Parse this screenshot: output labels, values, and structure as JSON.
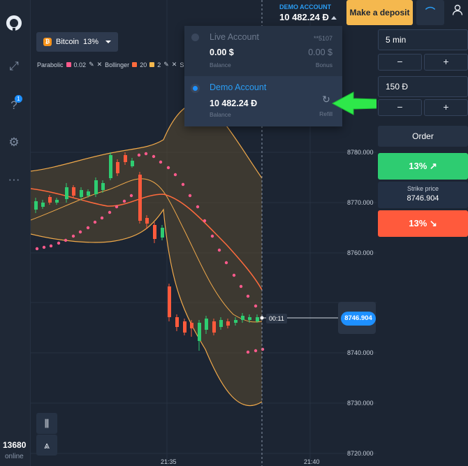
{
  "header": {
    "account_type": "DEMO ACCOUNT",
    "balance": "10 482.24 Đ",
    "deposit_label": "Make a deposit"
  },
  "asset": {
    "name": "Bitcoin",
    "payout": "13%"
  },
  "indicators": [
    {
      "name": "Parabolic",
      "value": "0.02",
      "color": "#ff5a8c"
    },
    {
      "name": "Bollinger",
      "value": "20",
      "color": "#ff6b3d"
    },
    {
      "name": "",
      "value": "2",
      "color": "#f5b84e"
    },
    {
      "name": "SMA",
      "value": "",
      "color": ""
    }
  ],
  "accounts": {
    "live": {
      "name": "Live Account",
      "id": "**5107",
      "balance": "0.00 $",
      "balance_label": "Balance",
      "bonus": "0.00 $",
      "bonus_label": "Bonus"
    },
    "demo": {
      "name": "Demo Account",
      "balance": "10 482.24 Đ",
      "balance_label": "Balance",
      "refill_label": "Refill"
    }
  },
  "trade": {
    "duration": "5 min",
    "amount": "150 Đ",
    "minus": "−",
    "plus": "+",
    "order_label": "Order",
    "up_label": "13% ↗",
    "strike_label": "Strike price",
    "strike_value": "8746.904",
    "down_label": "13% ↘"
  },
  "chart": {
    "price_labels": [
      "8780.000",
      "8770.000",
      "8760.000",
      "8740.000",
      "8730.000",
      "8720.000"
    ],
    "time_labels": [
      "21:35",
      "21:40"
    ],
    "timer": "00:11",
    "current_price": "8746.904"
  },
  "sidebar": {
    "online_count": "13680",
    "online_label": "online",
    "help_badge": "1"
  },
  "colors": {
    "up": "#2ecc71",
    "down": "#ff5a3c",
    "accent": "#1e90ff",
    "deposit": "#f5b84e"
  }
}
